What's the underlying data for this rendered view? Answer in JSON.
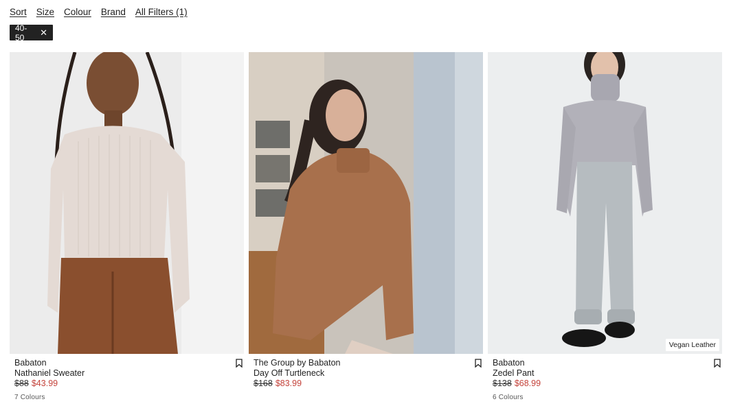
{
  "filters": {
    "sort": "Sort",
    "size": "Size",
    "colour": "Colour",
    "brand": "Brand",
    "all_filters": "All Filters (1)"
  },
  "active_filter": {
    "label": "40-50",
    "remove_icon": "close-icon"
  },
  "products": [
    {
      "brand": "Babaton",
      "name": "Nathaniel Sweater",
      "original_price": "$88",
      "sale_price": "$43.99",
      "colours": "7 Colours",
      "badge": ""
    },
    {
      "brand": "The Group by Babaton",
      "name": "Day Off Turtleneck",
      "original_price": "$168",
      "sale_price": "$83.99",
      "colours": "",
      "badge": ""
    },
    {
      "brand": "Babaton",
      "name": "Zedel Pant",
      "original_price": "$138",
      "sale_price": "$68.99",
      "colours": "6 Colours",
      "badge": "Vegan Leather"
    }
  ],
  "colors": {
    "sale": "#c4433b",
    "chip_bg": "#222222"
  }
}
